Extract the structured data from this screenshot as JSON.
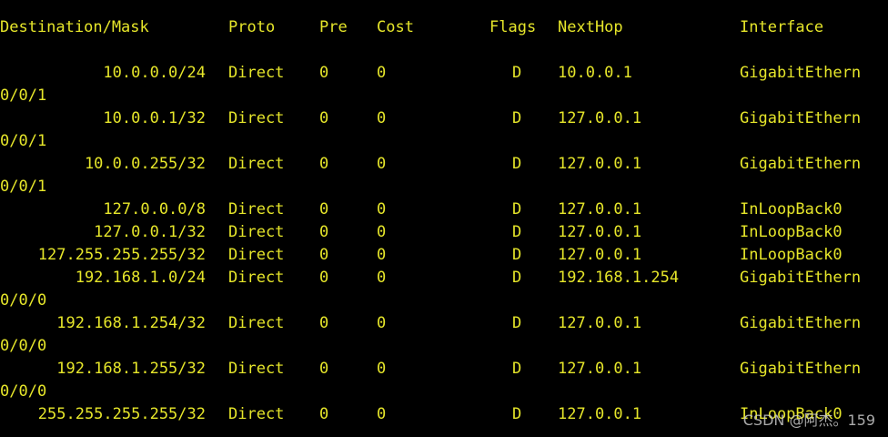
{
  "colors": {
    "background": "#000000",
    "text": "#e6e62a"
  },
  "header": {
    "destination": "Destination/Mask",
    "proto": "Proto",
    "pre": "Pre",
    "cost": "Cost",
    "flags": "Flags",
    "nexthop": "NextHop",
    "interface": "Interface"
  },
  "rows": [
    {
      "dest": "10.0.0.0/24",
      "proto": "Direct",
      "pre": "0",
      "cost": "0",
      "flag": "D",
      "nexthop": "10.0.0.1",
      "iface": "GigabitEthern",
      "cont": "0/0/1"
    },
    {
      "dest": "10.0.0.1/32",
      "proto": "Direct",
      "pre": "0",
      "cost": "0",
      "flag": "D",
      "nexthop": "127.0.0.1",
      "iface": "GigabitEthern",
      "cont": "0/0/1"
    },
    {
      "dest": "10.0.0.255/32",
      "proto": "Direct",
      "pre": "0",
      "cost": "0",
      "flag": "D",
      "nexthop": "127.0.0.1",
      "iface": "GigabitEthern",
      "cont": "0/0/1"
    },
    {
      "dest": "127.0.0.0/8",
      "proto": "Direct",
      "pre": "0",
      "cost": "0",
      "flag": "D",
      "nexthop": "127.0.0.1",
      "iface": "InLoopBack0"
    },
    {
      "dest": "127.0.0.1/32",
      "proto": "Direct",
      "pre": "0",
      "cost": "0",
      "flag": "D",
      "nexthop": "127.0.0.1",
      "iface": "InLoopBack0"
    },
    {
      "dest": "127.255.255.255/32",
      "proto": "Direct",
      "pre": "0",
      "cost": "0",
      "flag": "D",
      "nexthop": "127.0.0.1",
      "iface": "InLoopBack0"
    },
    {
      "dest": "192.168.1.0/24",
      "proto": "Direct",
      "pre": "0",
      "cost": "0",
      "flag": "D",
      "nexthop": "192.168.1.254",
      "iface": "GigabitEthern",
      "cont": "0/0/0"
    },
    {
      "dest": "192.168.1.254/32",
      "proto": "Direct",
      "pre": "0",
      "cost": "0",
      "flag": "D",
      "nexthop": "127.0.0.1",
      "iface": "GigabitEthern",
      "cont": "0/0/0"
    },
    {
      "dest": "192.168.1.255/32",
      "proto": "Direct",
      "pre": "0",
      "cost": "0",
      "flag": "D",
      "nexthop": "127.0.0.1",
      "iface": "GigabitEthern",
      "cont": "0/0/0"
    },
    {
      "dest": "255.255.255.255/32",
      "proto": "Direct",
      "pre": "0",
      "cost": "0",
      "flag": "D",
      "nexthop": "127.0.0.1",
      "iface": "InLoopBack0"
    }
  ],
  "watermark": "CSDN @阿杰。159"
}
